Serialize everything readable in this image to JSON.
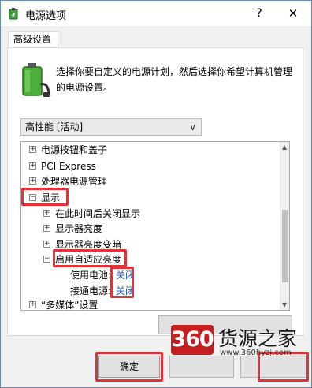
{
  "window": {
    "title": "电源选项",
    "help": "?",
    "close": "✕"
  },
  "tab": {
    "label": "高级设置"
  },
  "description": "选择你要自定义的电源计划，然后选择你希望计算机管理的电源设置。",
  "plan_select": {
    "value": "高性能 [活动]"
  },
  "tree": {
    "items": [
      {
        "label": "电源按钮和盖子",
        "toggle": "+"
      },
      {
        "label": "PCI Express",
        "toggle": "+"
      },
      {
        "label": "处理器电源管理",
        "toggle": "+"
      },
      {
        "label": "显示",
        "toggle": "−"
      },
      {
        "label": "在此时间后关闭显示",
        "toggle": "+"
      },
      {
        "label": "显示器亮度",
        "toggle": "+"
      },
      {
        "label": "显示器亮度变暗",
        "toggle": "+"
      },
      {
        "label": "启用自适应亮度",
        "toggle": "−"
      },
      {
        "label": "使用电池:",
        "value": "关闭"
      },
      {
        "label": "接通电源:",
        "value": "关闭"
      },
      {
        "label": "“多媒体”设置",
        "toggle": "+"
      }
    ]
  },
  "buttons": {
    "ok": "确定"
  },
  "watermark": {
    "logo": "360",
    "name": "货源之家",
    "url": "www.360hyzj.com"
  },
  "colors": {
    "highlight": "#e13338",
    "link": "#1a56c9",
    "brand": "#c41e20"
  }
}
